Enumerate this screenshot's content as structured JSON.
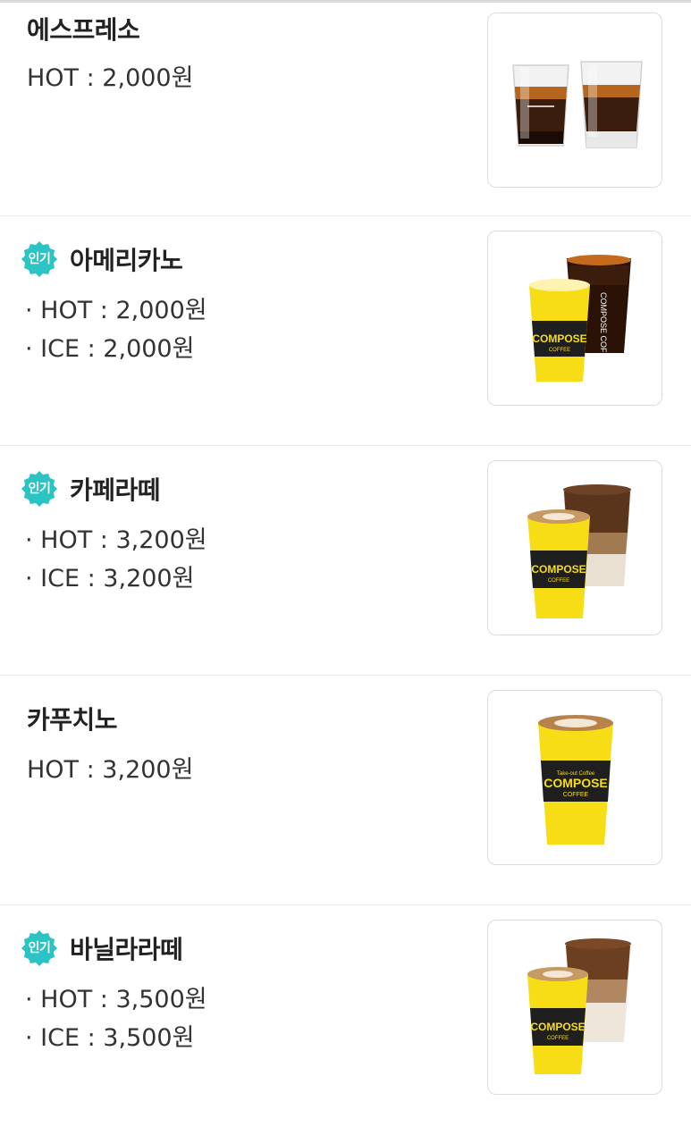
{
  "menu": [
    {
      "name": "에스프레소",
      "popular": false,
      "prices": [
        "HOT : 2,000원"
      ],
      "image": "espresso-shots-icon"
    },
    {
      "name": "아메리카노",
      "popular": true,
      "badge": "인기",
      "prices": [
        "· HOT : 2,000원",
        "· ICE : 2,000원"
      ],
      "image": "americano-cups-icon"
    },
    {
      "name": "카페라떼",
      "popular": true,
      "badge": "인기",
      "prices": [
        "· HOT : 3,200원",
        "· ICE : 3,200원"
      ],
      "image": "latte-cups-icon"
    },
    {
      "name": "카푸치노",
      "popular": false,
      "prices": [
        "HOT : 3,200원"
      ],
      "image": "cappuccino-cup-icon"
    },
    {
      "name": "바닐라라떼",
      "popular": true,
      "badge": "인기",
      "prices": [
        "· HOT : 3,500원",
        "· ICE : 3,500원"
      ],
      "image": "vanilla-latte-cups-icon"
    }
  ],
  "brand": {
    "cup_text": "COMPOSE",
    "cup_subtext": "COFFEE",
    "cup_tagline": "Take-out Coffee"
  },
  "colors": {
    "badge": "#2bc3c3",
    "cup_yellow": "#f6dd16",
    "sleeve": "#1f1f1f",
    "text": "#222222"
  }
}
